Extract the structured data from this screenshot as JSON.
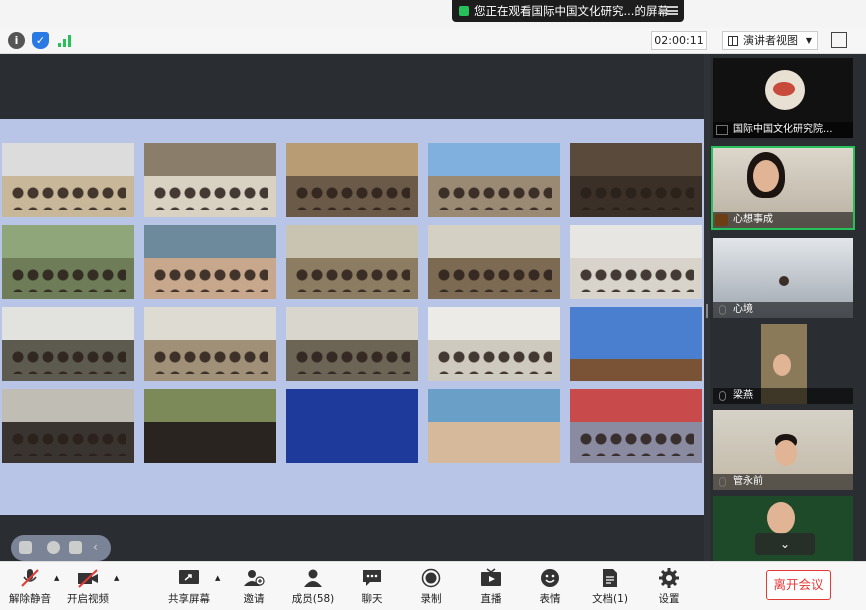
{
  "share_banner": {
    "text": "您正在观看国际中国文化研究...的屏幕"
  },
  "top_bar": {
    "timer": "02:00:11",
    "view_mode": "演讲者视图",
    "icons": [
      "info-icon",
      "shield-icon",
      "signal-icon",
      "fullscreen-icon"
    ],
    "colors": {
      "info": "#555555",
      "shield": "#2a7ae4",
      "signal": "#27c15b"
    }
  },
  "participants": [
    {
      "name": "国际中国文化研究院...",
      "badge": "share"
    },
    {
      "name": "心想事成",
      "badge": "host"
    },
    {
      "name": "心境",
      "badge": "none"
    },
    {
      "name": "梁燕",
      "badge": "none"
    },
    {
      "name": "管永前",
      "badge": "none"
    }
  ],
  "controls": {
    "mute": "解除静音",
    "video": "开启视频",
    "share": "共享屏幕",
    "invite": "邀请",
    "members": "成员(58)",
    "chat": "聊天",
    "record": "录制",
    "live": "直播",
    "reactions": "表情",
    "docs": "文档(1)",
    "settings": "设置",
    "leave": "离开会议"
  },
  "accent_colors": {
    "leave": "#e53935",
    "active_speaker": "#27c15b",
    "muted": "#e53935"
  }
}
